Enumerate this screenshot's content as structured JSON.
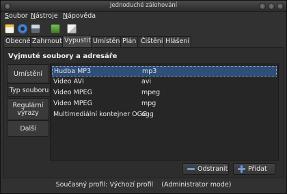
{
  "window": {
    "title": "Jednoduché zálohování"
  },
  "menu": [
    "Soubor",
    "Nástroje",
    "Nápověda"
  ],
  "toolbar": {
    "icons": [
      "calendar-icon",
      "refresh-icon",
      "save-icon",
      "backup-icon",
      "copy-icon"
    ]
  },
  "tabs": [
    "Obecné",
    "Zahrnout",
    "Vypustit",
    "Umístění",
    "Plán",
    "Čištění",
    "Hlášení"
  ],
  "active_tab": "Vypustit",
  "section_title": "Vyjmuté soubory a adresáře",
  "side_tabs": [
    "Umístění",
    "Typ souboru",
    "Regulární výrazy",
    "Další"
  ],
  "active_side_tab": "Typ souboru",
  "rows": [
    {
      "name": "Hudba MP3",
      "ext": "mp3"
    },
    {
      "name": "Video AVI",
      "ext": "avi"
    },
    {
      "name": "Video MPEG",
      "ext": "mpeg"
    },
    {
      "name": "Video MPEG",
      "ext": "mpg"
    },
    {
      "name": "Multimediální kontejner OGG",
      "ext": "ogg"
    }
  ],
  "buttons": {
    "remove": "Odstranit",
    "add": "Přidat"
  },
  "status": "Současný profil: Výchozí profil    (Administrator mode)"
}
